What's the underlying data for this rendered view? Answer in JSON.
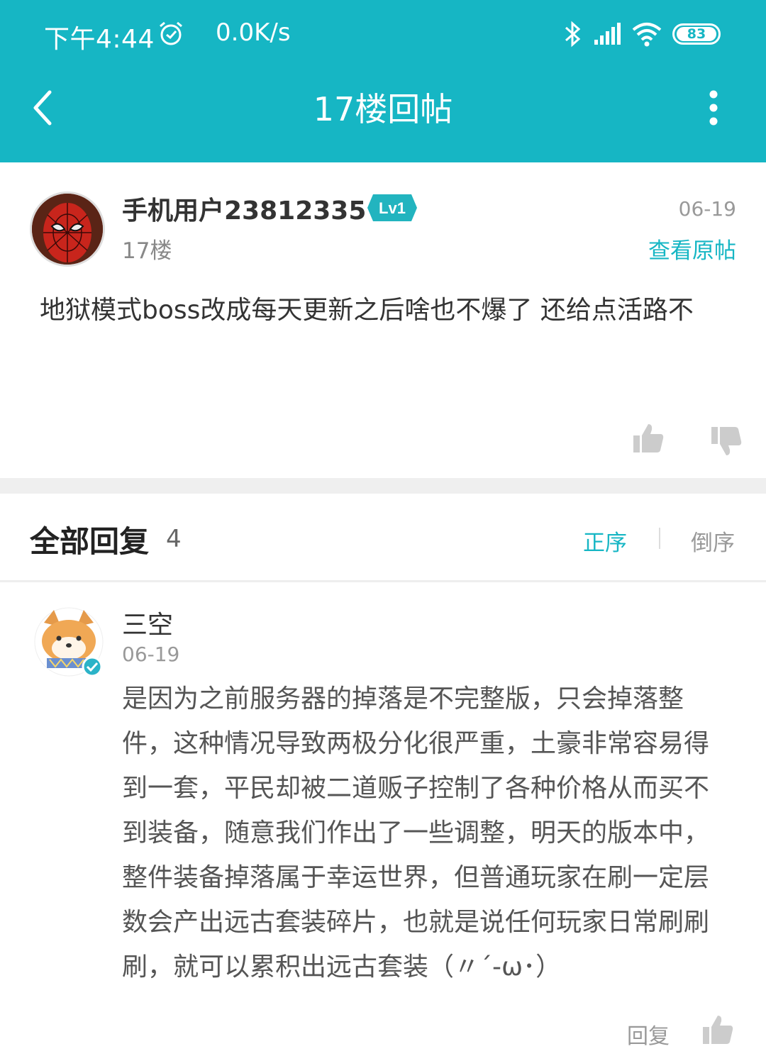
{
  "status_bar": {
    "time": "下午4:44",
    "net_speed": "0.0K/s",
    "battery": "83",
    "icons": [
      "alarm-icon",
      "bluetooth-icon",
      "signal-icon",
      "wifi-icon",
      "battery-icon"
    ]
  },
  "header": {
    "title": "17楼回帖",
    "back_icon": "chevron-left-icon",
    "more_icon": "more-vertical-icon"
  },
  "post": {
    "username": "手机用户23812335",
    "level": "Lv1",
    "floor": "17楼",
    "date": "06-19",
    "view_original": "查看原帖",
    "content": "地狱模式boss改成每天更新之后啥也不爆了 还给点活路不"
  },
  "replies": {
    "title": "全部回复",
    "count": "4",
    "order_asc": "正序",
    "order_desc": "倒序",
    "items": [
      {
        "username": "三空",
        "date": "06-19",
        "content": "是因为之前服务器的掉落是不完整版，只会掉落整件，这种情况导致两极分化很严重，土豪非常容易得到一套，平民却被二道贩子控制了各种价格从而买不到装备，随意我们作出了一些调整，明天的版本中，整件装备掉落属于幸运世界，但普通玩家在刷一定层数会产出远古套装碎片，也就是说任何玩家日常刷刷刷，就可以累积出远古套装（〃´-ω･）",
        "reply_label": "回复"
      }
    ]
  },
  "colors": {
    "accent": "#16b6c4",
    "separator": "#efefef"
  }
}
